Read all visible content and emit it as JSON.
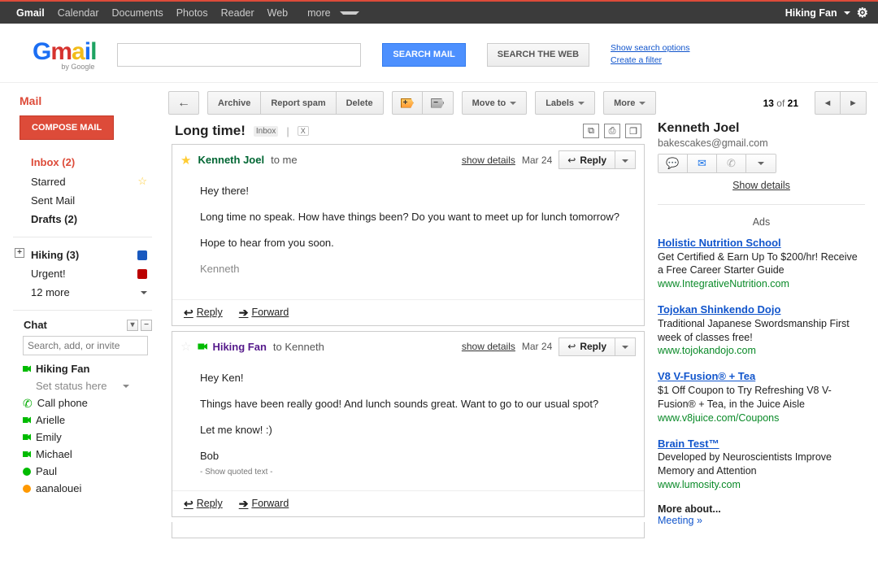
{
  "topnav": {
    "items": [
      "Gmail",
      "Calendar",
      "Documents",
      "Photos",
      "Reader",
      "Web"
    ],
    "more": "more",
    "user": "Hiking Fan"
  },
  "search": {
    "btn_mail": "SEARCH MAIL",
    "btn_web": "SEARCH THE WEB",
    "opt1": "Show search options",
    "opt2": "Create a filter"
  },
  "sidebar": {
    "head": "Mail",
    "compose": "COMPOSE MAIL",
    "items": [
      {
        "label": "Inbox (2)",
        "bold": true,
        "active": true
      },
      {
        "label": "Starred"
      },
      {
        "label": "Sent Mail"
      },
      {
        "label": "Drafts (2)",
        "bold": true
      }
    ],
    "labels": [
      {
        "label": "Hiking (3)",
        "bold": true,
        "expander": "+",
        "sq": "blue"
      },
      {
        "label": "Urgent!",
        "sq": "red"
      },
      {
        "label": "12 more"
      }
    ],
    "chat_head": "Chat",
    "chat_placeholder": "Search, add, or invite",
    "chat_self": "Hiking Fan",
    "chat_status": "Set status here",
    "call_phone": "Call phone",
    "contacts": [
      {
        "name": "Arielle",
        "p": "cam"
      },
      {
        "name": "Emily",
        "p": "cam"
      },
      {
        "name": "Michael",
        "p": "cam"
      },
      {
        "name": "Paul",
        "p": "dot"
      },
      {
        "name": "aanalouei",
        "p": "idle"
      }
    ]
  },
  "toolbar": {
    "archive": "Archive",
    "spam": "Report spam",
    "delete": "Delete",
    "moveto": "Move to",
    "labels": "Labels",
    "more": "More",
    "count_pos": "13",
    "count_of": "of",
    "count_total": "21"
  },
  "thread": {
    "subject": "Long time!",
    "label_chip": "Inbox",
    "messages": [
      {
        "star": true,
        "cam": false,
        "sender": "Kenneth Joel",
        "sender_cls": "green",
        "to": "to me",
        "show": "show details",
        "date": "Mar 24",
        "reply": "Reply",
        "body": [
          "Hey there!",
          "Long time no speak.  How have things been?  Do you want to meet up for lunch tomorrow?",
          "Hope to hear from you soon."
        ],
        "sig": "Kenneth",
        "foot_reply": "Reply",
        "foot_fwd": "Forward"
      },
      {
        "star": false,
        "cam": true,
        "sender": "Hiking Fan",
        "sender_cls": "purple",
        "to": "to Kenneth",
        "show": "show details",
        "date": "Mar 24",
        "reply": "Reply",
        "body": [
          "Hey Ken!",
          "Things have been really good! And lunch sounds great. Want to go to our usual spot?",
          "Let me know! :)"
        ],
        "sig": "Bob",
        "quoted": "- Show quoted text -",
        "foot_reply": "Reply",
        "foot_fwd": "Forward"
      }
    ]
  },
  "contact": {
    "name": "Kenneth Joel",
    "email": "bakescakes@gmail.com",
    "show": "Show details"
  },
  "ads": {
    "head": "Ads",
    "items": [
      {
        "t": "Holistic Nutrition School",
        "d": "Get Certified & Earn Up To $200/hr! Receive a Free Career Starter Guide",
        "u": "www.IntegrativeNutrition.com"
      },
      {
        "t": "Tojokan Shinkendo Dojo",
        "d": "Traditional Japanese Swordsmanship First week of classes free!",
        "u": "www.tojokandojo.com"
      },
      {
        "t": "V8 V-Fusion® + Tea",
        "d": "$1 Off Coupon to Try Refreshing V8 V-Fusion® + Tea, in the Juice Aisle",
        "u": "www.v8juice.com/Coupons"
      },
      {
        "t": "Brain Test™",
        "d": "Developed by Neuroscientists Improve Memory and Attention",
        "u": "www.lumosity.com"
      }
    ],
    "more": "More about...",
    "more_link": "Meeting »"
  }
}
